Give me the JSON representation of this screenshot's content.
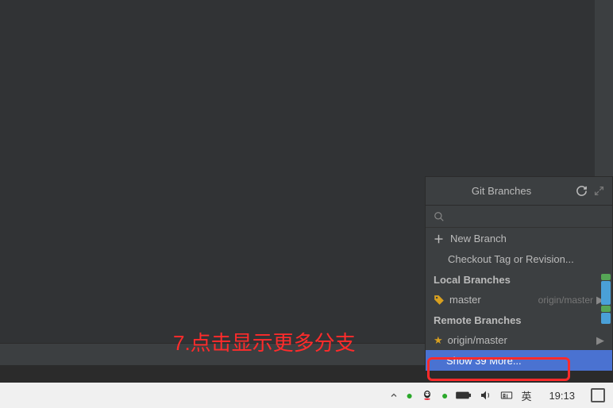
{
  "annotation": "7.点击显示更多分支",
  "popup": {
    "title": "Git Branches",
    "search_placeholder": "",
    "new_branch": "New Branch",
    "checkout_tag": "Checkout Tag or Revision...",
    "local_header": "Local Branches",
    "local": [
      {
        "name": "master",
        "tracking": "origin/master"
      }
    ],
    "remote_header": "Remote Branches",
    "remote": [
      {
        "name": "origin/master"
      }
    ],
    "show_more": "Show 39 More..."
  },
  "taskbar": {
    "ime": "英",
    "time": "19:13"
  }
}
